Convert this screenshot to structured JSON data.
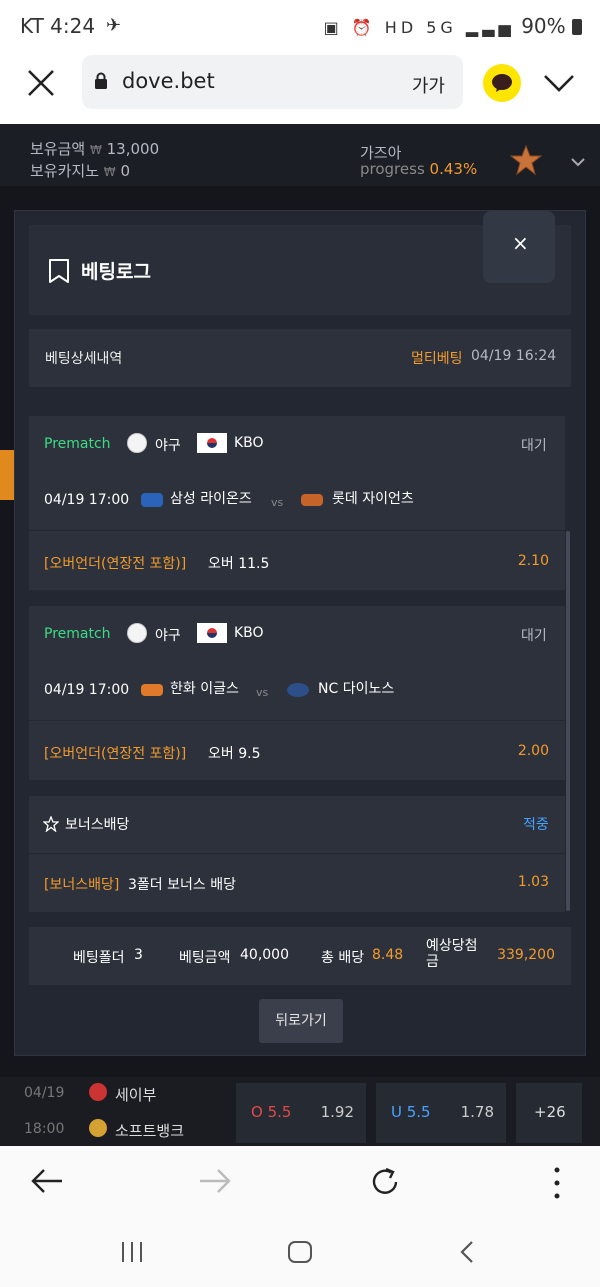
{
  "status_bar": {
    "carrier_time": "KT 4:24",
    "battery": "90%"
  },
  "browser": {
    "url": "dove.bet",
    "text_size_label": "가가"
  },
  "account": {
    "balance_label": "보유금액",
    "balance_currency": "₩",
    "balance_value": "13,000",
    "casino_label": "보유카지노",
    "casino_currency": "₩",
    "casino_value": "0",
    "level_name": "가즈아",
    "progress_label": "progress",
    "progress_value": "0.43%"
  },
  "modal": {
    "title": "베팅로그",
    "close": "×",
    "detail_label": "베팅상세내역",
    "bet_type": "멀티베팅",
    "bet_datetime": "04/19 16:24",
    "bets": [
      {
        "tag": "Prematch",
        "sport": "야구",
        "league": "KBO",
        "status": "대기",
        "datetime": "04/19 17:00",
        "home": "삼성 라이온즈",
        "vs": "vs",
        "away": "롯데 자이언츠",
        "market": "[오버언더(연장전 포함)]",
        "pick": "오버 11.5",
        "odds": "2.10"
      },
      {
        "tag": "Prematch",
        "sport": "야구",
        "league": "KBO",
        "status": "대기",
        "datetime": "04/19 17:00",
        "home": "한화 이글스",
        "vs": "vs",
        "away": "NC 다이노스",
        "market": "[오버언더(연장전 포함)]",
        "pick": "오버 9.5",
        "odds": "2.00"
      }
    ],
    "bonus": {
      "title": "보너스배당",
      "status": "적중",
      "market": "[보너스배당]",
      "pick": "3폴더 보너스 배당",
      "odds": "1.03"
    },
    "summary": {
      "folders_label": "베팅폴더",
      "folders_value": "3",
      "amount_label": "베팅금액",
      "amount_value": "40,000",
      "total_odds_label": "총 배당",
      "total_odds_value": "8.48",
      "expected_label": "예상당첨금",
      "expected_value": "339,200"
    },
    "back_button": "뒤로가기"
  },
  "background_match": {
    "date": "04/19",
    "time": "18:00",
    "team1": "세이부",
    "team2": "소프트뱅크",
    "over_label": "O 5.5",
    "over_odds": "1.92",
    "under_label": "U 5.5",
    "under_odds": "1.78",
    "more": "+26"
  },
  "colors": {
    "accent_orange": "#f39b2a",
    "prematch_green": "#3ddc84",
    "hit_blue": "#47a3ff",
    "kakao_yellow": "#fee500"
  }
}
